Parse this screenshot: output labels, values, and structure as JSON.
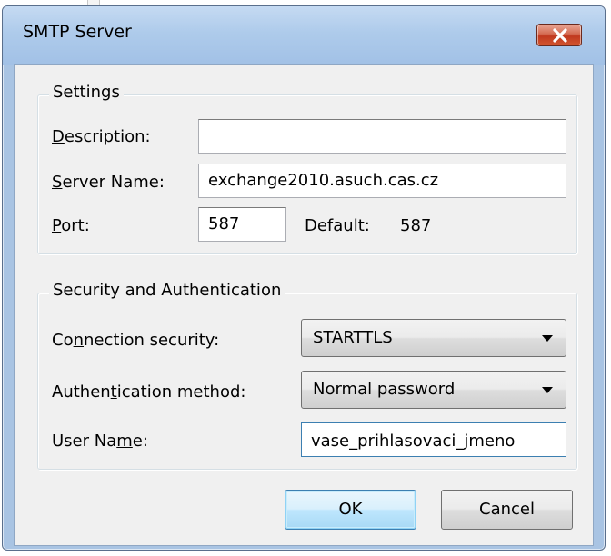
{
  "window": {
    "title": "SMTP Server",
    "close_glyph": "✕"
  },
  "settings": {
    "legend": "Settings",
    "description": {
      "label_key": "D",
      "label_rest": "escription:",
      "value": ""
    },
    "server_name": {
      "label_key": "S",
      "label_rest": "erver Name:",
      "value": "exchange2010.asuch.cas.cz"
    },
    "port": {
      "label_key": "P",
      "label_rest": "ort:",
      "value": "587"
    },
    "default_label": "Default:",
    "default_value": "587"
  },
  "security": {
    "legend": "Security and Authentication",
    "connection": {
      "label_pre": "Co",
      "label_key": "n",
      "label_rest": "nection security:",
      "value": "STARTTLS"
    },
    "auth": {
      "label_pre": "Authen",
      "label_key": "t",
      "label_rest": "ication method:",
      "value": "Normal password"
    },
    "username": {
      "label_pre": "User Na",
      "label_key": "m",
      "label_rest": "e:",
      "value": "vase_prihlasovaci_jmeno"
    }
  },
  "buttons": {
    "ok": "OK",
    "cancel": "Cancel"
  },
  "colors": {
    "titlebar": "#aecbeb",
    "client_bg": "#f0f0f0",
    "close_red": "#c0391f",
    "focus_border": "#3c7fb1"
  },
  "icons": {
    "close": "close-icon",
    "dropdown": "chevron-down-icon"
  }
}
